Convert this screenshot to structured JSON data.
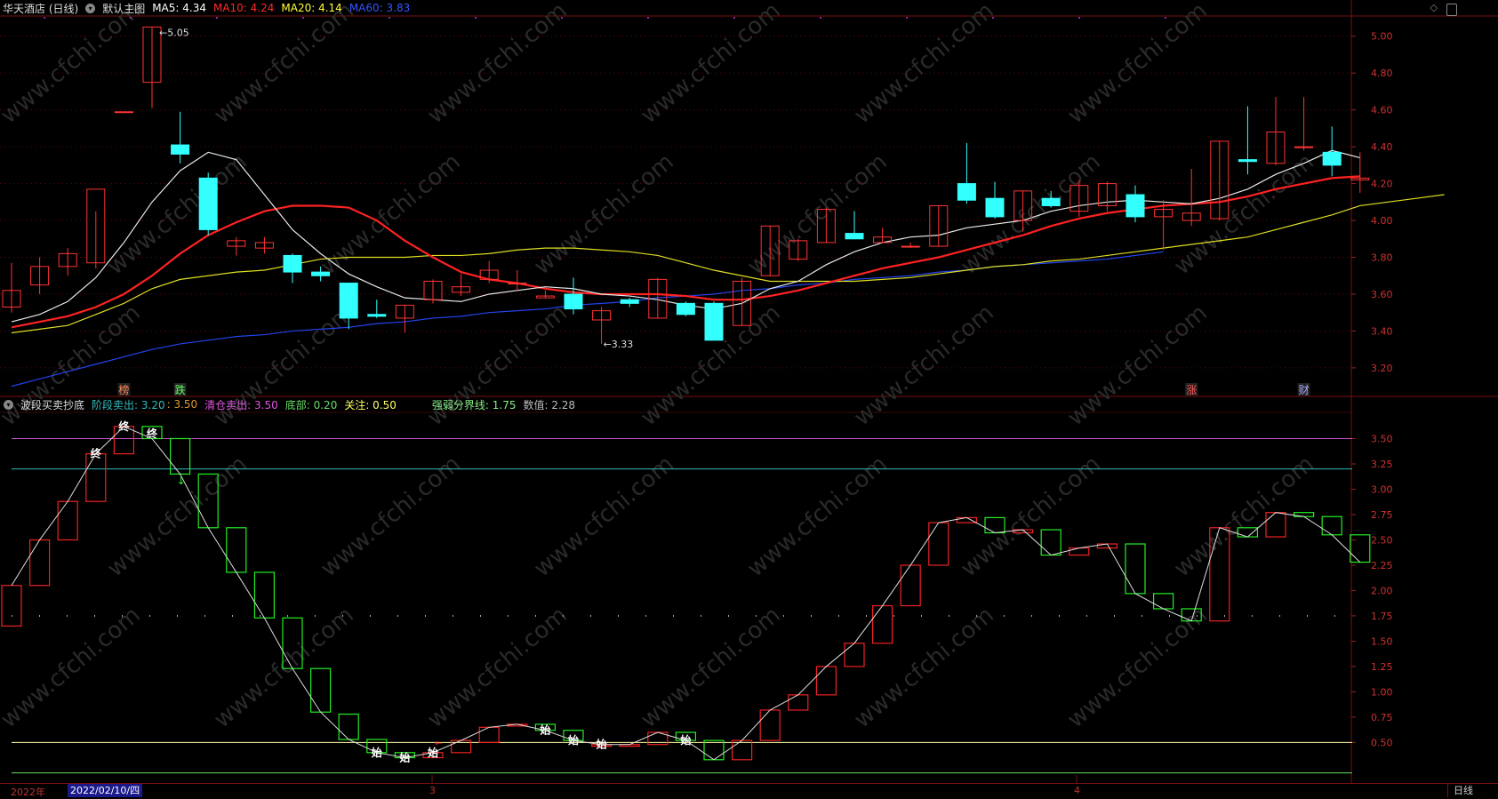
{
  "main": {
    "stock_name": "华天酒店 (日线)",
    "template_label": "默认主图",
    "ma": [
      {
        "label": "MA5: 4.34",
        "color": "#ffffff"
      },
      {
        "label": "MA10: 4.24",
        "color": "#ff2a2a"
      },
      {
        "label": "MA20: 4.14",
        "color": "#ffff33"
      },
      {
        "label": "MA60: 3.83",
        "color": "#3355ff"
      }
    ],
    "high_label": "←5.05",
    "low_label": "←3.33",
    "y_ticks": [
      "5.00",
      "4.80",
      "4.60",
      "4.40",
      "4.20",
      "4.00",
      "3.80",
      "3.60",
      "3.40",
      "3.20"
    ],
    "markers": [
      {
        "text": "榜",
        "color": "#ff8855"
      },
      {
        "text": "跌",
        "color": "#66ff66"
      },
      {
        "text": "涨",
        "color": "#ff5555"
      },
      {
        "text": "财",
        "color": "#aaaaff"
      }
    ]
  },
  "indicator": {
    "title": "波段买卖抄底",
    "stage_sell_label": "阶段卖出: 3.20",
    "stage_sell_val2": ": 3.50",
    "clear_sell_label": "清仓卖出: 3.50",
    "bottom_label": "底部: 0.20",
    "watch_label": "关注: 0.50",
    "strength_label": "强弱分界线: 1.75",
    "value_label": "数值: 2.28",
    "y_ticks": [
      "3.50",
      "3.25",
      "3.00",
      "2.75",
      "2.50",
      "2.25",
      "2.00",
      "1.75",
      "1.50",
      "1.25",
      "1.00",
      "0.75",
      "0.50"
    ],
    "signals": {
      "end": "终",
      "start": "始"
    }
  },
  "watermark": "www.cfchi.com",
  "footer": {
    "year": "2022年",
    "cursor_date": "2022/02/10/四",
    "month3": "3",
    "month4": "4",
    "period": "日线"
  },
  "chart_data": [
    {
      "type": "candlestick",
      "title": "华天酒店 (日线)",
      "ylim": [
        3.05,
        5.1
      ],
      "candles": [
        {
          "o": 3.53,
          "h": 3.77,
          "l": 3.5,
          "c": 3.62
        },
        {
          "o": 3.65,
          "h": 3.8,
          "l": 3.6,
          "c": 3.75
        },
        {
          "o": 3.75,
          "h": 3.85,
          "l": 3.7,
          "c": 3.82
        },
        {
          "o": 3.77,
          "h": 4.05,
          "l": 3.74,
          "c": 4.17
        },
        {
          "o": 4.59,
          "h": 4.59,
          "l": 4.59,
          "c": 4.59
        },
        {
          "o": 4.75,
          "h": 5.05,
          "l": 4.61,
          "c": 5.05
        },
        {
          "o": 4.41,
          "h": 4.59,
          "l": 4.31,
          "c": 4.36
        },
        {
          "o": 4.23,
          "h": 4.26,
          "l": 3.92,
          "c": 3.95
        },
        {
          "o": 3.86,
          "h": 3.91,
          "l": 3.81,
          "c": 3.89
        },
        {
          "o": 3.85,
          "h": 3.91,
          "l": 3.82,
          "c": 3.88
        },
        {
          "o": 3.81,
          "h": 3.82,
          "l": 3.66,
          "c": 3.72
        },
        {
          "o": 3.72,
          "h": 3.75,
          "l": 3.67,
          "c": 3.7
        },
        {
          "o": 3.66,
          "h": 3.66,
          "l": 3.41,
          "c": 3.47
        },
        {
          "o": 3.49,
          "h": 3.57,
          "l": 3.47,
          "c": 3.48
        },
        {
          "o": 3.47,
          "h": 3.54,
          "l": 3.39,
          "c": 3.54
        },
        {
          "o": 3.57,
          "h": 3.68,
          "l": 3.55,
          "c": 3.67
        },
        {
          "o": 3.61,
          "h": 3.71,
          "l": 3.59,
          "c": 3.64
        },
        {
          "o": 3.68,
          "h": 3.78,
          "l": 3.66,
          "c": 3.73
        },
        {
          "o": 3.66,
          "h": 3.73,
          "l": 3.62,
          "c": 3.66
        },
        {
          "o": 3.58,
          "h": 3.62,
          "l": 3.58,
          "c": 3.59
        },
        {
          "o": 3.6,
          "h": 3.69,
          "l": 3.49,
          "c": 3.52
        },
        {
          "o": 3.46,
          "h": 3.53,
          "l": 3.33,
          "c": 3.51
        },
        {
          "o": 3.57,
          "h": 3.58,
          "l": 3.53,
          "c": 3.55
        },
        {
          "o": 3.47,
          "h": 3.69,
          "l": 3.47,
          "c": 3.68
        },
        {
          "o": 3.55,
          "h": 3.56,
          "l": 3.48,
          "c": 3.49
        },
        {
          "o": 3.55,
          "h": 3.56,
          "l": 3.35,
          "c": 3.35
        },
        {
          "o": 3.43,
          "h": 3.69,
          "l": 3.43,
          "c": 3.67
        },
        {
          "o": 3.7,
          "h": 3.97,
          "l": 3.7,
          "c": 3.97
        },
        {
          "o": 3.79,
          "h": 3.9,
          "l": 3.78,
          "c": 3.89
        },
        {
          "o": 3.88,
          "h": 4.07,
          "l": 3.88,
          "c": 4.06
        },
        {
          "o": 3.93,
          "h": 4.05,
          "l": 3.9,
          "c": 3.9
        },
        {
          "o": 3.88,
          "h": 3.96,
          "l": 3.88,
          "c": 3.91
        },
        {
          "o": 3.86,
          "h": 3.88,
          "l": 3.85,
          "c": 3.86
        },
        {
          "o": 3.86,
          "h": 4.08,
          "l": 3.86,
          "c": 4.08
        },
        {
          "o": 4.2,
          "h": 4.42,
          "l": 4.09,
          "c": 4.11
        },
        {
          "o": 4.12,
          "h": 4.21,
          "l": 4.01,
          "c": 4.02
        },
        {
          "o": 4.0,
          "h": 4.16,
          "l": 3.94,
          "c": 4.16
        },
        {
          "o": 4.12,
          "h": 4.16,
          "l": 4.07,
          "c": 4.08
        },
        {
          "o": 4.05,
          "h": 4.22,
          "l": 4.02,
          "c": 4.19
        },
        {
          "o": 4.08,
          "h": 4.21,
          "l": 4.05,
          "c": 4.2
        },
        {
          "o": 4.14,
          "h": 4.19,
          "l": 3.99,
          "c": 4.02
        },
        {
          "o": 4.02,
          "h": 4.11,
          "l": 3.84,
          "c": 4.06
        },
        {
          "o": 4.0,
          "h": 4.28,
          "l": 3.97,
          "c": 4.04
        },
        {
          "o": 4.01,
          "h": 4.43,
          "l": 4.0,
          "c": 4.43
        },
        {
          "o": 4.33,
          "h": 4.62,
          "l": 4.25,
          "c": 4.32
        },
        {
          "o": 4.31,
          "h": 4.67,
          "l": 4.3,
          "c": 4.48
        },
        {
          "o": 4.4,
          "h": 4.67,
          "l": 4.38,
          "c": 4.4
        },
        {
          "o": 4.37,
          "h": 4.51,
          "l": 4.24,
          "c": 4.3
        },
        {
          "o": 4.22,
          "h": 4.37,
          "l": 4.15,
          "c": 4.23
        }
      ],
      "ma5": [
        3.45,
        3.49,
        3.56,
        3.69,
        3.88,
        4.1,
        4.27,
        4.37,
        4.33,
        4.14,
        3.95,
        3.82,
        3.71,
        3.64,
        3.58,
        3.57,
        3.56,
        3.6,
        3.62,
        3.64,
        3.63,
        3.6,
        3.59,
        3.57,
        3.54,
        3.52,
        3.55,
        3.63,
        3.67,
        3.76,
        3.83,
        3.88,
        3.91,
        3.92,
        3.96,
        3.98,
        4.0,
        4.05,
        4.08,
        4.1,
        4.11,
        4.1,
        4.09,
        4.12,
        4.17,
        4.25,
        4.31,
        4.38,
        4.34
      ],
      "ma10": [
        3.42,
        3.45,
        3.48,
        3.53,
        3.6,
        3.7,
        3.82,
        3.92,
        3.99,
        4.05,
        4.08,
        4.08,
        4.07,
        4.0,
        3.89,
        3.8,
        3.72,
        3.68,
        3.66,
        3.63,
        3.61,
        3.6,
        3.6,
        3.6,
        3.59,
        3.57,
        3.57,
        3.59,
        3.62,
        3.66,
        3.7,
        3.74,
        3.77,
        3.8,
        3.84,
        3.88,
        3.92,
        3.97,
        4.01,
        4.04,
        4.06,
        4.08,
        4.09,
        4.1,
        4.13,
        4.17,
        4.2,
        4.23,
        4.24
      ],
      "ma20": [
        3.39,
        3.41,
        3.43,
        3.49,
        3.55,
        3.63,
        3.68,
        3.7,
        3.72,
        3.73,
        3.76,
        3.79,
        3.8,
        3.8,
        3.8,
        3.81,
        3.81,
        3.82,
        3.84,
        3.85,
        3.85,
        3.84,
        3.83,
        3.81,
        3.77,
        3.73,
        3.7,
        3.67,
        3.67,
        3.67,
        3.67,
        3.68,
        3.69,
        3.71,
        3.73,
        3.75,
        3.76,
        3.78,
        3.79,
        3.81,
        3.83,
        3.85,
        3.87,
        3.89,
        3.91,
        3.95,
        3.99,
        4.03,
        4.08,
        4.1,
        4.12,
        4.14
      ],
      "ma60": [
        3.1,
        3.14,
        3.18,
        3.22,
        3.26,
        3.3,
        3.33,
        3.35,
        3.37,
        3.38,
        3.4,
        3.41,
        3.42,
        3.44,
        3.45,
        3.47,
        3.48,
        3.5,
        3.51,
        3.52,
        3.54,
        3.55,
        3.56,
        3.58,
        3.59,
        3.6,
        3.62,
        3.63,
        3.65,
        3.66,
        3.68,
        3.69,
        3.7,
        3.72,
        3.73,
        3.75,
        3.76,
        3.77,
        3.78,
        3.79,
        3.81,
        3.83
      ]
    },
    {
      "type": "bar",
      "title": "波段买卖抄底",
      "ylim": [
        0.1,
        3.75
      ],
      "reference_lines": [
        {
          "value": 3.5,
          "color": "#cc55cc"
        },
        {
          "value": 3.2,
          "color": "#33bbbb"
        },
        {
          "value": 1.75,
          "color": "#dddddd",
          "style": "dotted"
        },
        {
          "value": 0.5,
          "color": "#ffffaa"
        },
        {
          "value": 0.2,
          "color": "#66dd66"
        }
      ],
      "boxes": [
        {
          "o": 1.65,
          "c": 2.05
        },
        {
          "o": 2.05,
          "c": 2.5
        },
        {
          "o": 2.5,
          "c": 2.88
        },
        {
          "o": 2.88,
          "c": 3.35
        },
        {
          "o": 3.35,
          "c": 3.62
        },
        {
          "o": 3.62,
          "c": 3.5
        },
        {
          "o": 3.5,
          "c": 3.15
        },
        {
          "o": 3.15,
          "c": 2.62
        },
        {
          "o": 2.62,
          "c": 2.18
        },
        {
          "o": 2.18,
          "c": 1.73
        },
        {
          "o": 1.73,
          "c": 1.23
        },
        {
          "o": 1.23,
          "c": 0.8
        },
        {
          "o": 0.78,
          "c": 0.53
        },
        {
          "o": 0.53,
          "c": 0.4
        },
        {
          "o": 0.4,
          "c": 0.35
        },
        {
          "o": 0.35,
          "c": 0.4
        },
        {
          "o": 0.4,
          "c": 0.52
        },
        {
          "o": 0.5,
          "c": 0.65
        },
        {
          "o": 0.68,
          "c": 0.68
        },
        {
          "o": 0.68,
          "c": 0.62
        },
        {
          "o": 0.62,
          "c": 0.52
        },
        {
          "o": 0.48,
          "c": 0.48
        },
        {
          "o": 0.48,
          "c": 0.48
        },
        {
          "o": 0.48,
          "c": 0.6
        },
        {
          "o": 0.6,
          "c": 0.52
        },
        {
          "o": 0.52,
          "c": 0.33
        },
        {
          "o": 0.33,
          "c": 0.52
        },
        {
          "o": 0.52,
          "c": 0.82
        },
        {
          "o": 0.82,
          "c": 0.97
        },
        {
          "o": 0.97,
          "c": 1.25
        },
        {
          "o": 1.25,
          "c": 1.48
        },
        {
          "o": 1.48,
          "c": 1.85
        },
        {
          "o": 1.85,
          "c": 2.25
        },
        {
          "o": 2.25,
          "c": 2.67
        },
        {
          "o": 2.67,
          "c": 2.72
        },
        {
          "o": 2.72,
          "c": 2.57
        },
        {
          "o": 2.57,
          "c": 2.6
        },
        {
          "o": 2.6,
          "c": 2.35
        },
        {
          "o": 2.35,
          "c": 2.42
        },
        {
          "o": 2.42,
          "c": 2.46
        },
        {
          "o": 2.46,
          "c": 1.97
        },
        {
          "o": 1.97,
          "c": 1.82
        },
        {
          "o": 1.82,
          "c": 1.7
        },
        {
          "o": 1.7,
          "c": 2.62
        },
        {
          "o": 2.62,
          "c": 2.53
        },
        {
          "o": 2.53,
          "c": 2.77
        },
        {
          "o": 2.77,
          "c": 2.73
        },
        {
          "o": 2.73,
          "c": 2.55
        },
        {
          "o": 2.55,
          "c": 2.28
        }
      ]
    }
  ]
}
